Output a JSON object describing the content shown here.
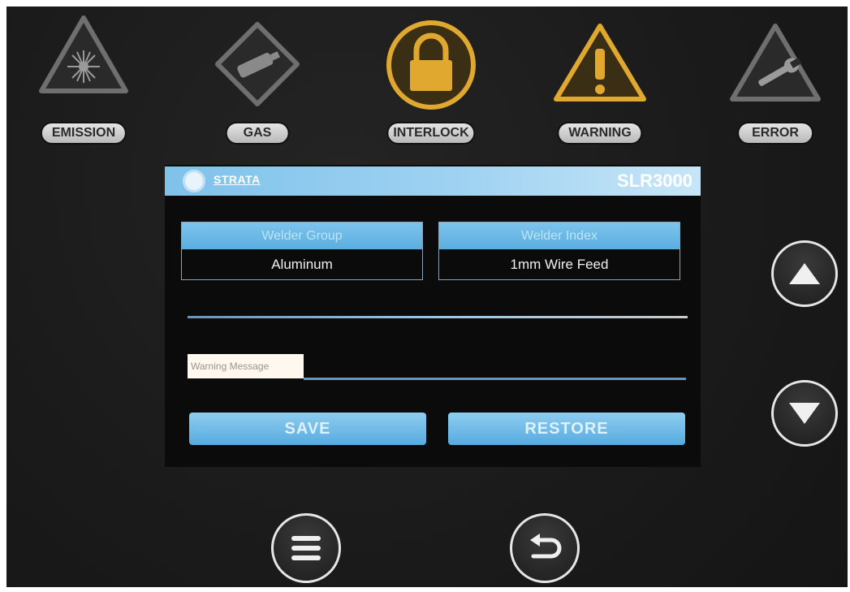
{
  "indicators": [
    {
      "label": "EMISSION",
      "icon": "laser-radiation-icon"
    },
    {
      "label": "GAS",
      "icon": "gas-cylinder-icon"
    },
    {
      "label": "INTERLOCK",
      "icon": "padlock-icon",
      "active_color": "#e0a82e"
    },
    {
      "label": "WARNING",
      "icon": "exclamation-warning-icon",
      "active_color": "#e0a82e"
    },
    {
      "label": "ERROR",
      "icon": "wrench-error-icon"
    }
  ],
  "header": {
    "brand": "STRATA",
    "model": "SLR3000"
  },
  "fields": {
    "welder_group": {
      "label": "Welder Group",
      "value": "Aluminum"
    },
    "welder_index": {
      "label": "Welder Index",
      "value": "1mm Wire Feed"
    }
  },
  "warning_message": {
    "label": "Warning Message"
  },
  "buttons": {
    "save": "SAVE",
    "restore": "RESTORE"
  },
  "nav": {
    "up": "chevron-up-icon",
    "down": "chevron-down-icon",
    "menu": "menu-icon",
    "back": "back-arrow-icon"
  },
  "colors": {
    "accent": "#6cb8e8",
    "active": "#e0a82e",
    "panel": "#1a1a1a"
  }
}
